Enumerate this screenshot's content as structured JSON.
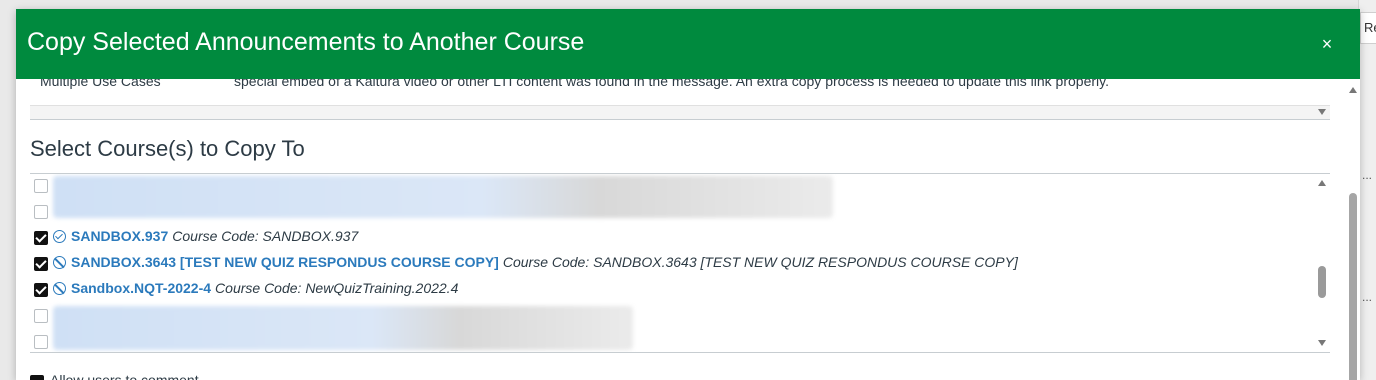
{
  "dialog": {
    "title": "Copy Selected Announcements to Another Course",
    "close_symbol": "×"
  },
  "message_preview": {
    "left_text": "Multiple Use Cases",
    "right_text": "special embed of a Kaltura video or other LTI content was found in the message. An extra copy process is needed to update this link properly."
  },
  "course_section": {
    "heading": "Select Course(s) to Copy To",
    "courses": [
      {
        "name": "SANDBOX.937",
        "code": "Course Code: SANDBOX.937",
        "checked": true,
        "status": "published"
      },
      {
        "name": "SANDBOX.3643 [TEST NEW QUIZ RESPONDUS COURSE COPY]",
        "code": "Course Code: SANDBOX.3643 [TEST NEW QUIZ RESPONDUS COURSE COPY]",
        "checked": true,
        "status": "unpublished"
      },
      {
        "name": "Sandbox.NQT-2022-4",
        "code": "Course Code: NewQuizTraining.2022.4",
        "checked": true,
        "status": "unpublished"
      }
    ]
  },
  "options": {
    "allow_comment_label": "Allow users to comment",
    "allow_comment_checked": true
  },
  "background": {
    "tab_label": "Re",
    "dots": "..."
  },
  "colors": {
    "header": "#008a3e",
    "link": "#2b7abc"
  }
}
